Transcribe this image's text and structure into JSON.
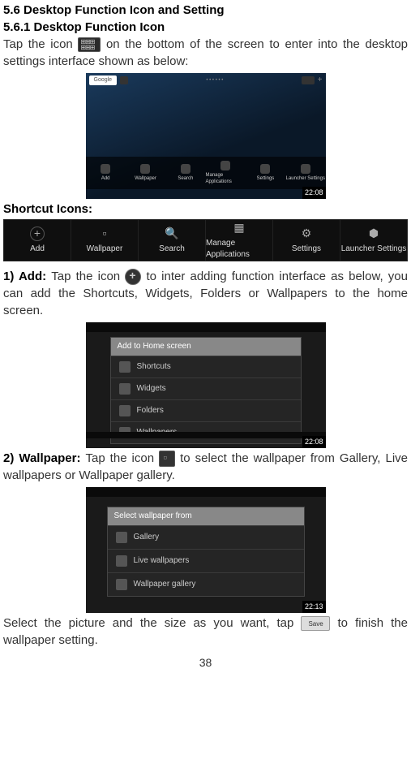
{
  "headings": {
    "h1": "5.6 Desktop Function Icon and Setting",
    "h2": "5.6.1 Desktop Function Icon"
  },
  "para1a": "Tap the icon ",
  "para1b": " on the bottom of the screen to enter into the desktop settings interface shown as below:",
  "shortcut_label": "Shortcut Icons:",
  "screenshot1": {
    "google": "Google",
    "clock": "22:08",
    "items": [
      "Add",
      "Wallpaper",
      "Search",
      "Manage Applications",
      "Settings",
      "Launcher Settings"
    ]
  },
  "shortcutbar": {
    "items": [
      "Add",
      "Wallpaper",
      "Search",
      "Manage Applications",
      "Settings",
      "Launcher Settings"
    ]
  },
  "section1": {
    "lead": "1) Add: ",
    "text_a": "Tap the icon ",
    "text_b": " to inter adding function interface as below, you can add the Shortcuts, Widgets, Folders or Wallpapers to the home screen."
  },
  "screenshot2": {
    "title": "Add to Home screen",
    "rows": [
      "Shortcuts",
      "Widgets",
      "Folders",
      "Wallpapers"
    ],
    "clock": "22:08"
  },
  "section2": {
    "lead": "2) Wallpaper: ",
    "text_a": "Tap the icon ",
    "text_b": " to select the wallpaper from Gallery, Live wallpapers or Wallpaper gallery."
  },
  "screenshot3": {
    "title": "Select wallpaper from",
    "rows": [
      "Gallery",
      "Live wallpapers",
      "Wallpaper gallery"
    ],
    "clock": "22:13"
  },
  "para_last_a": "Select the picture and the size as you want, tap",
  "para_last_b": " to finish the wallpaper setting.",
  "pagenum": "38"
}
